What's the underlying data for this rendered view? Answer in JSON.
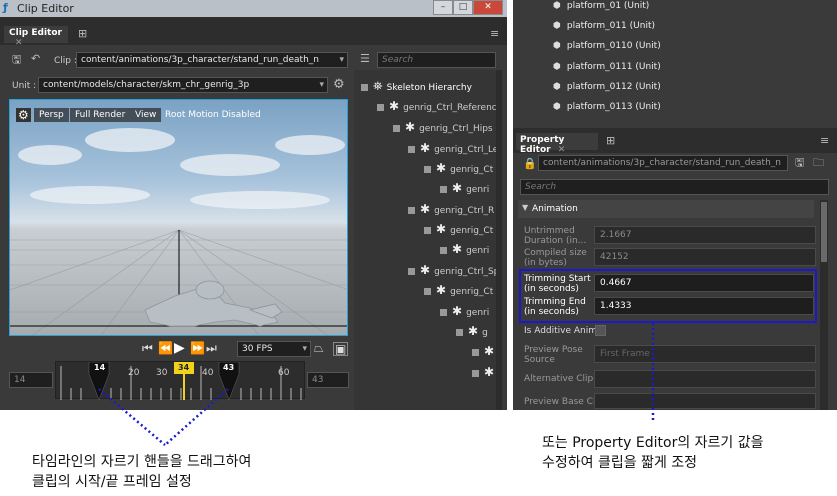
{
  "clip_editor": {
    "title": "Clip Editor",
    "tab": "Clip Editor",
    "clip_label": "Clip :",
    "clip_value": "content/animations/3p_character/stand_run_death_n",
    "unit_label": "Unit :",
    "unit_value": "content/models/character/skm_chr_genrig_3p",
    "search_placeholder": "Search",
    "viewport": {
      "persp": "Persp",
      "full_render": "Full Render",
      "view": "View",
      "root_motion": "Root Motion Disabled"
    },
    "fps": "30 FPS",
    "timeline": {
      "start": "14",
      "end": "43",
      "trim_start": "14",
      "trim_end": "43",
      "current": "34",
      "ticks": [
        "20",
        "30",
        "40",
        "60"
      ]
    }
  },
  "hierarchy": {
    "root": "Skeleton Hierarchy",
    "items": [
      "genrig_Ctrl_Reference",
      "genrig_Ctrl_Hips",
      "genrig_Ctrl_Le",
      "genrig_Ct",
      "genri",
      "genrig_Ctrl_R",
      "genrig_Ct",
      "genri",
      "genrig_Ctrl_Sp",
      "genrig_Ct",
      "genri",
      "g"
    ]
  },
  "scene_list": [
    "platform_01 (Unit)",
    "platform_011 (Unit)",
    "platform_0110 (Unit)",
    "platform_0111 (Unit)",
    "platform_0112 (Unit)",
    "platform_0113 (Unit)"
  ],
  "property_editor": {
    "tab": "Property Editor",
    "path": "content/animations/3p_character/stand_run_death_n",
    "search_placeholder": "Search",
    "section": "Animation",
    "rows": [
      {
        "label": "Untrimmed Duration (in...",
        "value": "2.1667"
      },
      {
        "label": "Compiled size (in bytes)",
        "value": "42152"
      },
      {
        "label": "Trimming Start (in seconds)",
        "value": "0.4667"
      },
      {
        "label": "Trimming End (in seconds)",
        "value": "1.4333"
      },
      {
        "label": "Is Additive Anim",
        "value": ""
      },
      {
        "label": "Preview Pose Source",
        "value": "First Frame"
      },
      {
        "label": "Alternative Clip",
        "value": ""
      },
      {
        "label": "Preview Base Clip",
        "value": ""
      }
    ]
  },
  "captions": {
    "left_line1": "타임라인의 자르기 핸들을 드래그하여",
    "left_line2": "클립의 시작/끝 프레임 설정",
    "right_line1": "또는 Property Editor의 자르기 값을",
    "right_line2": "수정하여 클립을 짧게 조정"
  },
  "colors": {
    "accent": "#1a1acc",
    "timeline_marker": "#f0d21c",
    "panel": "#3a3a3a"
  }
}
